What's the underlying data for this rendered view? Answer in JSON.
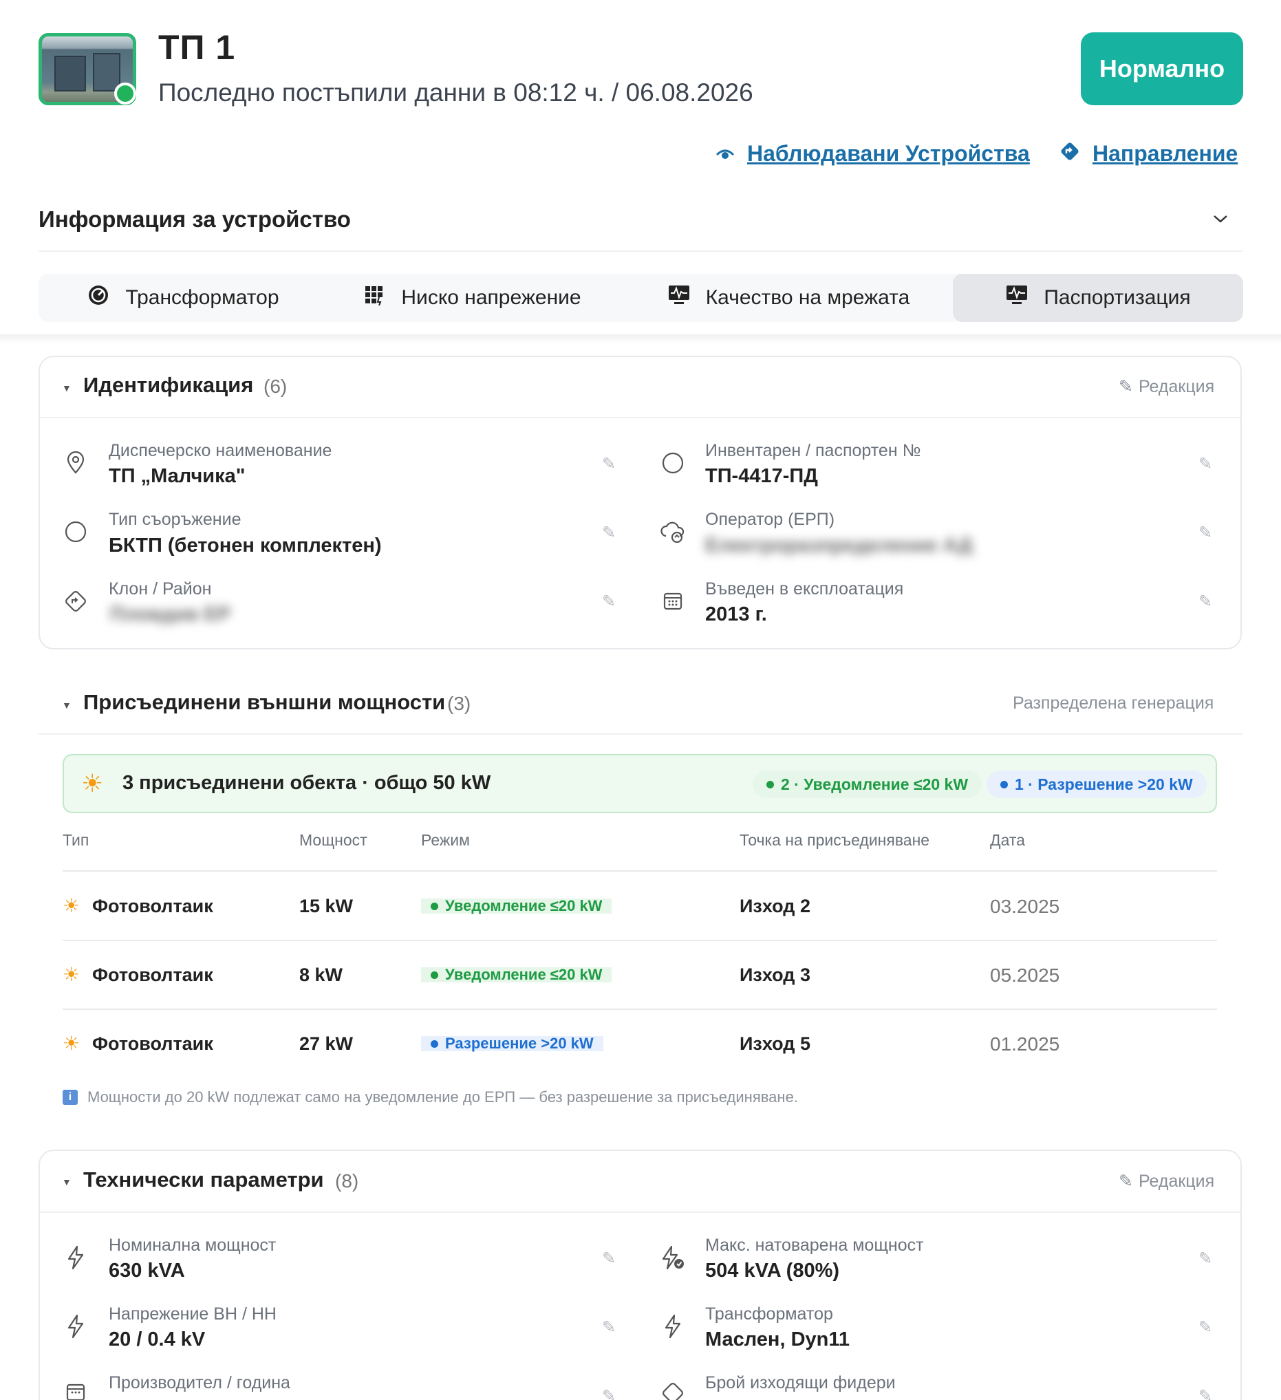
{
  "header": {
    "title": "ТП 1",
    "subtitle": "Последно постъпили данни в 08:12 ч. / 06.08.2026",
    "status": "Нормално"
  },
  "links": {
    "watched": "Наблюдавани Устройства",
    "direction": "Направление"
  },
  "info_section": {
    "title": "Информация за устройство"
  },
  "tabs": [
    {
      "label": "Трансформатор",
      "icon": "gauge-icon"
    },
    {
      "label": "Ниско напрежение",
      "icon": "grid-icon"
    },
    {
      "label": "Качество на мрежата",
      "icon": "monitor-pulse-icon"
    },
    {
      "label": "Паспортизация",
      "icon": "monitor-pulse-icon",
      "active": true
    }
  ],
  "identification": {
    "title": "Идентификация",
    "count": "(6)",
    "edit": "Редакция",
    "fields": [
      {
        "label": "Диспечерско наименование",
        "value": "ТП „Малчика\""
      },
      {
        "label": "Инвентарен / паспортен №",
        "value": "ТП-4417-ПД"
      },
      {
        "label": "Тип съоръжение",
        "value": "БКТП (бетонен комплектен)"
      },
      {
        "label": "Оператор (ЕРП)",
        "value": "Електроразпределение АД"
      },
      {
        "label": "Клон / Район",
        "value": "Пловдив ЕР"
      },
      {
        "label": "Въведен в експлоатация",
        "value": "2013 г."
      }
    ]
  },
  "external_power": {
    "title": "Присъединени външни мощности",
    "count": "(3)",
    "right_label": "Разпределена генерация",
    "summary": "3 присъединени обекта · общо 50 kW",
    "pill_notify": "2 · Уведомление ≤20 kW",
    "pill_permit": "1 · Разрешение >20 kW",
    "columns": [
      "Тип",
      "Мощност",
      "Режим",
      "Точка на присъединяване",
      "Дата"
    ],
    "rows": [
      {
        "type": "Фотоволтаик",
        "power": "15 kW",
        "mode": "Уведомление ≤20 kW",
        "mode_kind": "green",
        "point": "Изход 2",
        "date": "03.2025"
      },
      {
        "type": "Фотоволтаик",
        "power": "8 kW",
        "mode": "Уведомление ≤20 kW",
        "mode_kind": "green",
        "point": "Изход 3",
        "date": "05.2025"
      },
      {
        "type": "Фотоволтаик",
        "power": "27 kW",
        "mode": "Разрешение >20 kW",
        "mode_kind": "blue",
        "point": "Изход 5",
        "date": "01.2025"
      }
    ],
    "note": "Мощности до 20 kW подлежат само на уведомление до ЕРП — без разрешение за присъединяване."
  },
  "technical": {
    "title": "Технически параметри",
    "count": "(8)",
    "edit": "Редакция",
    "fields": [
      {
        "label": "Номинална мощност",
        "value": "630 kVA"
      },
      {
        "label": "Макс. натоварена мощност",
        "value": "504 kVA (80%)"
      },
      {
        "label": "Напрежение ВН / НН",
        "value": "20 / 0.4 kV"
      },
      {
        "label": "Трансформатор",
        "value": "Маслен, Dyn11"
      },
      {
        "label": "Производител / година",
        "value": ""
      },
      {
        "label": "Брой изходящи фидери",
        "value": ""
      }
    ]
  },
  "colors": {
    "accent": "#17b3a0",
    "link": "#1a6fa8",
    "online": "#21b35a"
  }
}
